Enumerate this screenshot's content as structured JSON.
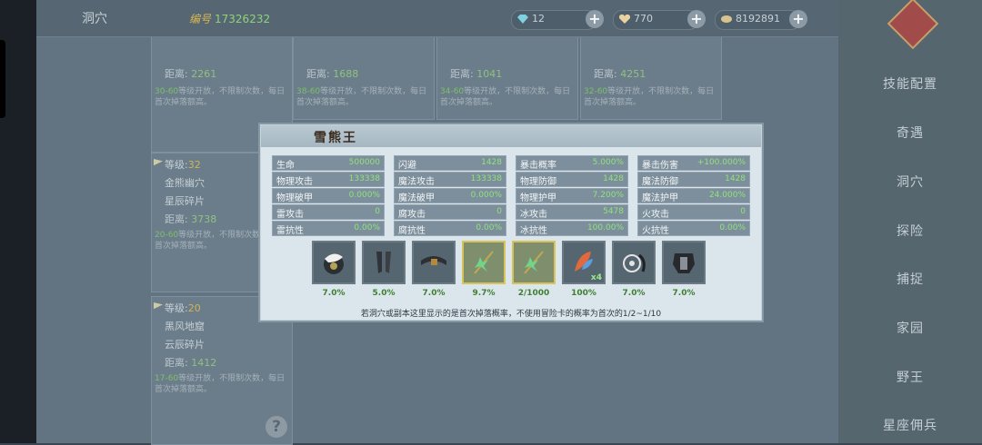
{
  "topbar": {
    "title": "洞穴",
    "id_label": "编号",
    "id_value": "17326232",
    "currencies": [
      {
        "icon": "diamond-icon",
        "value": "12",
        "color": "#7fd0e0"
      },
      {
        "icon": "heart-icon",
        "value": "770",
        "color": "#e8d2a0"
      },
      {
        "icon": "coin-icon",
        "value": "8192891",
        "color": "#d8c28e"
      }
    ]
  },
  "caves": [
    {
      "distance_label": "距离:",
      "distance": "2261",
      "note_lv": "30-60",
      "note": "等级开放，不限制次数，每日首次掉落额高。"
    },
    {
      "distance_label": "距离:",
      "distance": "1688",
      "note_lv": "38-60",
      "note": "等级开放，不限制次数，每日首次掉落额高。"
    },
    {
      "distance_label": "距离:",
      "distance": "1041",
      "note_lv": "34-60",
      "note": "等级开放，不限制次数，每日首次掉落额高。"
    },
    {
      "distance_label": "距离:",
      "distance": "4251",
      "note_lv": "32-60",
      "note": "等级开放，不限制次数，每日首次掉落额高。"
    },
    {
      "level_label": "等级:",
      "level": "32",
      "name": "金熊幽穴",
      "fragment": "星辰碎片",
      "distance_label": "距离:",
      "distance": "3738",
      "note_lv": "20-60",
      "note": "等级开放，不限制次数，每日首次掉落额高。"
    },
    {
      "level_label": "等级:",
      "level": "20",
      "name": "黑风地窟",
      "fragment": "云辰碎片",
      "distance_label": "距离:",
      "distance": "1412",
      "note_lv": "17-60",
      "note": "等级开放，不限制次数，每日首次掉落额高。"
    }
  ],
  "menu": [
    "技能配置",
    "奇遇",
    "洞穴",
    "探险",
    "捕捉",
    "家园",
    "野王",
    "星座佣兵"
  ],
  "modal": {
    "title": "雪熊王",
    "stats": [
      [
        {
          "label": "生命",
          "value": "500000"
        },
        {
          "label": "闪避",
          "value": "1428"
        },
        {
          "label": "暴击概率",
          "value": "5.000%"
        },
        {
          "label": "暴击伤害",
          "value": "+100.000%"
        }
      ],
      [
        {
          "label": "物理攻击",
          "value": "133338"
        },
        {
          "label": "魔法攻击",
          "value": "133338"
        },
        {
          "label": "物理防御",
          "value": "1428"
        },
        {
          "label": "魔法防御",
          "value": "1428"
        }
      ],
      [
        {
          "label": "物理破甲",
          "value": "0.000%"
        },
        {
          "label": "魔法破甲",
          "value": "0.000%"
        },
        {
          "label": "物理护甲",
          "value": "7.200%"
        },
        {
          "label": "魔法护甲",
          "value": "24.000%"
        }
      ],
      [
        {
          "label": "雷攻击",
          "value": "0"
        },
        {
          "label": "腐攻击",
          "value": "0"
        },
        {
          "label": "冰攻击",
          "value": "5478"
        },
        {
          "label": "火攻击",
          "value": "0"
        }
      ],
      [
        {
          "label": "雷抗性",
          "value": "0.00%"
        },
        {
          "label": "腐抗性",
          "value": "0.00%"
        },
        {
          "label": "冰抗性",
          "value": "100.00%"
        },
        {
          "label": "火抗性",
          "value": "0.00%"
        }
      ]
    ],
    "drops": [
      {
        "icon": "bear-helm-icon",
        "rate": "7.0%",
        "highlight": false
      },
      {
        "icon": "dark-boots-icon",
        "rate": "5.0%",
        "highlight": false
      },
      {
        "icon": "belt-icon",
        "rate": "7.0%",
        "highlight": false
      },
      {
        "icon": "green-staff-icon",
        "rate": "9.7%",
        "highlight": true
      },
      {
        "icon": "green-staff-icon",
        "rate": "2/1000",
        "highlight": true
      },
      {
        "icon": "feather-gem-icon",
        "rate": "100%",
        "highlight": false,
        "count": "x4"
      },
      {
        "icon": "wheel-chain-icon",
        "rate": "7.0%",
        "highlight": false
      },
      {
        "icon": "dark-armor-icon",
        "rate": "7.0%",
        "highlight": false
      }
    ],
    "footer": "若洞穴或副本这里显示的是首次掉落概率，不使用冒险卡的概率为首次的1/2~1/10"
  }
}
